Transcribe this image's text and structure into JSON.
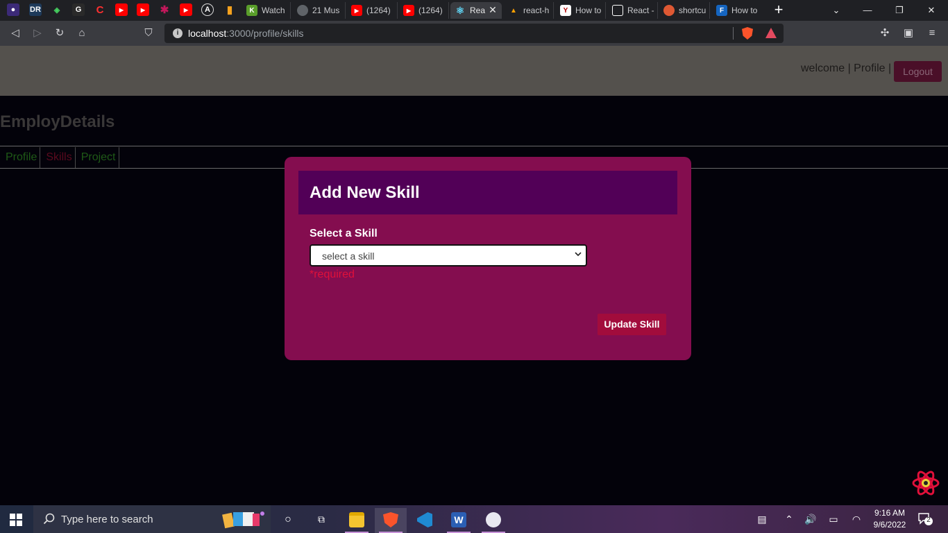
{
  "browser": {
    "pinned_tabs": [
      "DR",
      "G",
      "C"
    ],
    "tabs": [
      {
        "title": "Watch",
        "color": "#5a9e2b",
        "icon": "K"
      },
      {
        "title": "21 Mus",
        "color": "#5f6368",
        "icon": "🌐"
      },
      {
        "title": "(1264)",
        "color": "#ff0000",
        "icon": "▶"
      },
      {
        "title": "(1264)",
        "color": "#ff0000",
        "icon": "▶"
      },
      {
        "title": "Rea",
        "color": "#61dafb",
        "icon": "⚛"
      },
      {
        "title": "react-h",
        "color": "#ffa000",
        "icon": "🔥"
      },
      {
        "title": "How to",
        "color": "#ffffff",
        "icon": "Y"
      },
      {
        "title": "React -",
        "color": "#ffffff",
        "icon": "□"
      },
      {
        "title": "shortcu",
        "color": "#de5833",
        "icon": "●"
      },
      {
        "title": "How to",
        "color": "#1565c0",
        "icon": "F"
      }
    ],
    "active_tab_close": "✕",
    "new_tab": "+",
    "url_host": "localhost",
    "url_path": ":3000/profile/skills",
    "colors": {
      "brave": "#fb542b",
      "tabbar": "#1f2024",
      "toolbar": "#3a3b40"
    }
  },
  "page": {
    "header": {
      "welcome_text": "welcome | Profile |",
      "logout_label": "Logout"
    },
    "brand": "EmployDetails",
    "nav": {
      "profile": "Profile",
      "skills": "Skills",
      "project": "Project"
    },
    "modal": {
      "title": "Add New Skill",
      "field_label": "Select a Skill",
      "select_value": "select a skill",
      "required_text": "*required",
      "submit_label": "Update Skill"
    },
    "colors": {
      "header_bg": "#54514d",
      "modal_bg": "#840d4f",
      "modal_head_bg": "#520057",
      "button_bg": "#a20c3c",
      "error": "#e0103a"
    }
  },
  "taskbar": {
    "search_placeholder": "Type here to search",
    "time": "9:16 AM",
    "date": "9/6/2022",
    "notification_count": "2",
    "apps": [
      "file-explorer",
      "brave",
      "vscode",
      "word",
      "paint"
    ]
  }
}
